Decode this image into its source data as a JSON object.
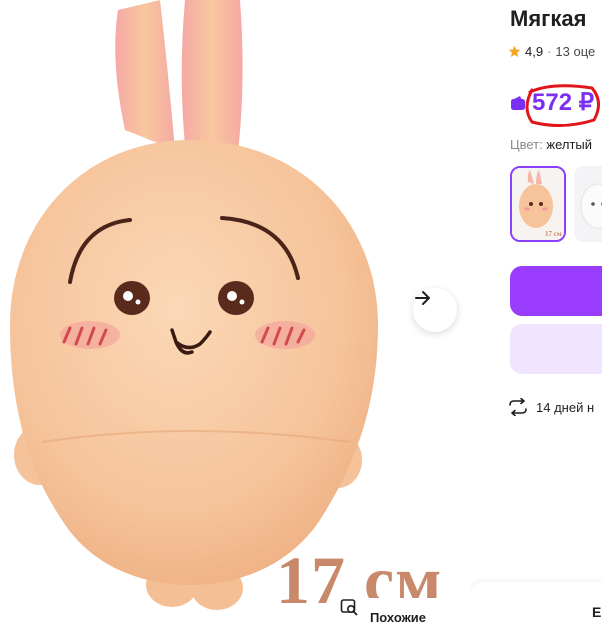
{
  "product": {
    "title": "Мягкая",
    "rating": "4,9",
    "separator": "·",
    "reviews": "13 оце",
    "price": "572 ₽",
    "color_key": "Цвет:",
    "color_value": "желтый",
    "size_caption": "17 см",
    "swatch_size_caption": "17 см",
    "return_text": "14 дней н",
    "bottom_panel_letter": "E"
  },
  "gallery": {
    "similar_label": "Похожие"
  },
  "colors": {
    "accent": "#9a3cfb",
    "accent_light": "#f1e4fe",
    "price": "#7b2ff2",
    "price_circle": "#e0161b",
    "star": "#f5a623",
    "plush_body": "#f7c9a3"
  },
  "icons": {
    "next": "arrow-right-icon",
    "similar": "search-similar-icon",
    "wallet": "wallet-icon",
    "star": "star-icon",
    "return": "return-arrows-icon"
  }
}
